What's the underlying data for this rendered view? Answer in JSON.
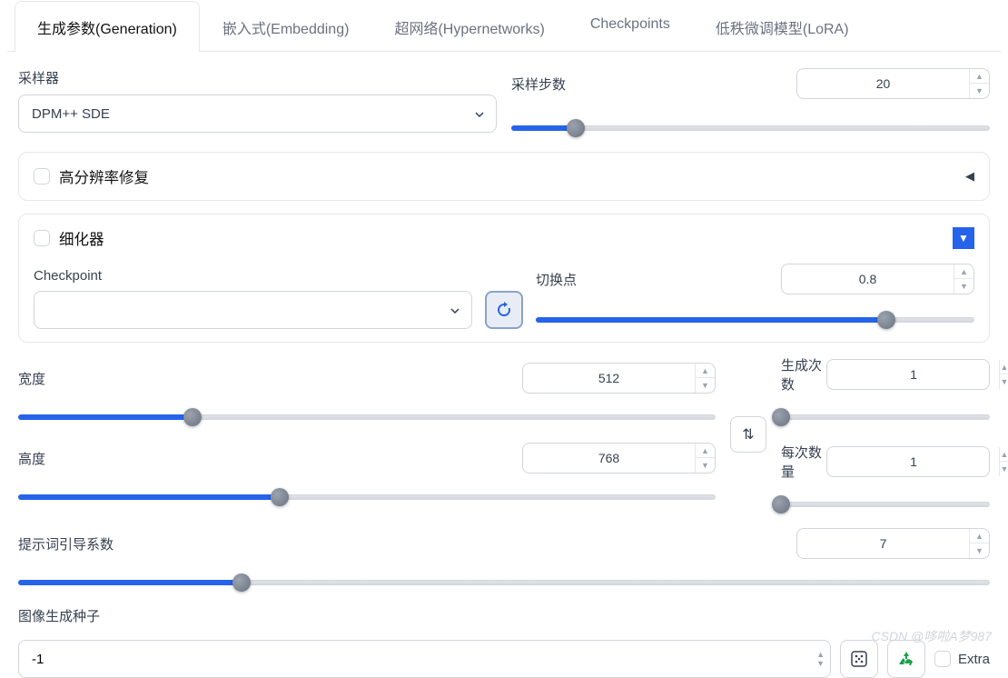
{
  "tabs": [
    "生成参数(Generation)",
    "嵌入式(Embedding)",
    "超网络(Hypernetworks)",
    "Checkpoints",
    "低秩微调模型(LoRA)"
  ],
  "active_tab": 0,
  "sampler": {
    "label": "采样器",
    "value": "DPM++ SDE"
  },
  "steps": {
    "label": "采样步数",
    "value": "20",
    "pct": 13.5
  },
  "hires": {
    "label": "高分辨率修复"
  },
  "refiner": {
    "label": "细化器",
    "checkpoint_label": "Checkpoint",
    "checkpoint_value": "",
    "switch_label": "切换点",
    "switch_value": "0.8",
    "switch_pct": 80
  },
  "width": {
    "label": "宽度",
    "value": "512",
    "pct": 25
  },
  "height": {
    "label": "高度",
    "value": "768",
    "pct": 37.5
  },
  "batch_count": {
    "label": "生成次数",
    "value": "1",
    "pct": 0
  },
  "batch_size": {
    "label": "每次数量",
    "value": "1",
    "pct": 0
  },
  "cfg": {
    "label": "提示词引导系数",
    "value": "7",
    "pct": 23
  },
  "seed": {
    "label": "图像生成种子",
    "value": "-1",
    "extra_label": "Extra"
  },
  "watermark": "CSDN @哆啦A梦987"
}
